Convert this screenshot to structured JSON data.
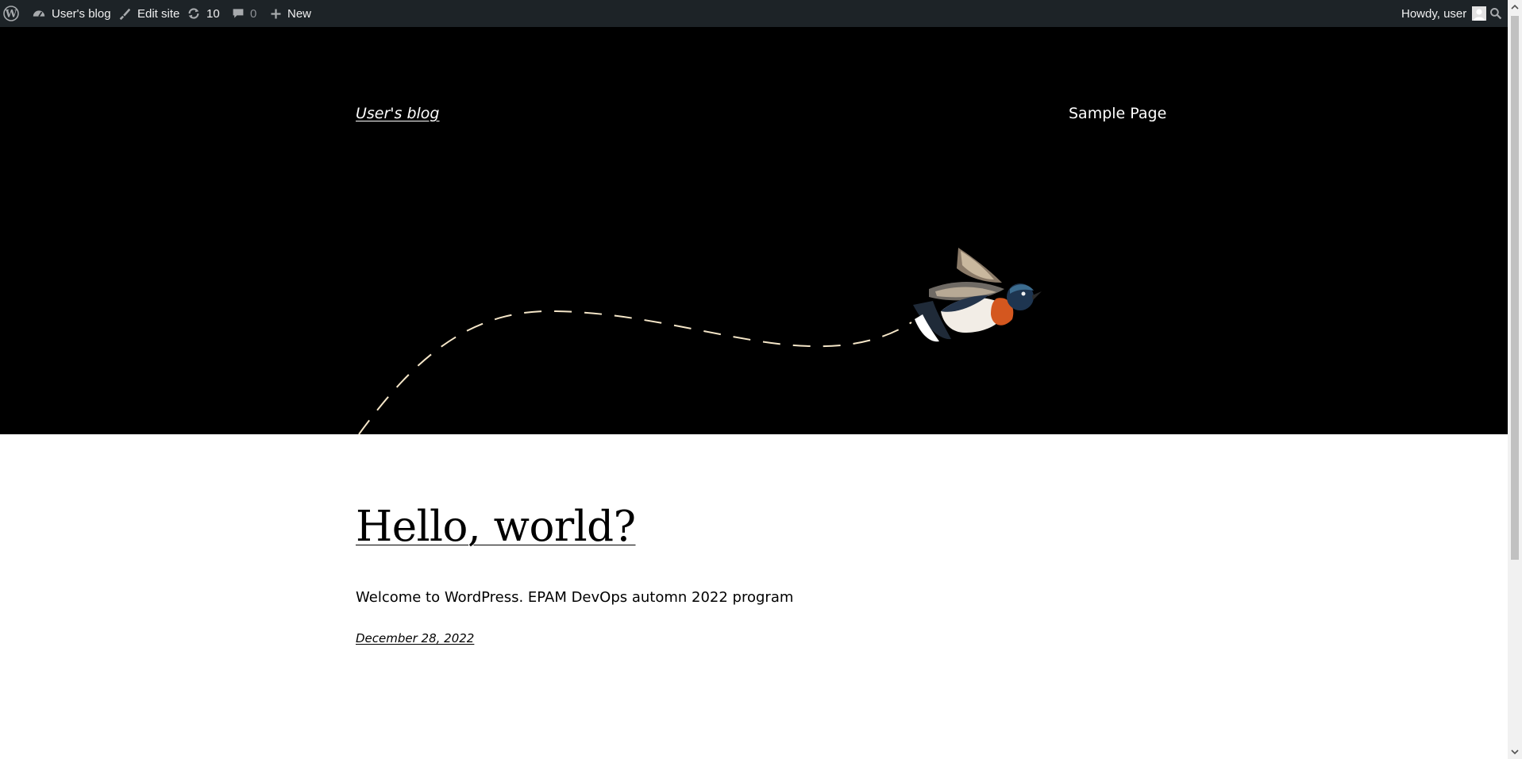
{
  "admin_bar": {
    "wp_logo_icon": "wordpress-logo-icon",
    "site_name": "User's blog",
    "edit_site": "Edit site",
    "updates_count": "10",
    "comments_count": "0",
    "new_label": "New",
    "howdy": "Howdy, user",
    "search_icon": "search-icon"
  },
  "header": {
    "site_title": "User's blog",
    "nav": [
      {
        "label": "Sample Page"
      }
    ]
  },
  "post": {
    "title": "Hello, world?",
    "excerpt": "Welcome to WordPress. EPAM DevOps automn 2022 program",
    "date": "December 28, 2022"
  },
  "colors": {
    "admin_bar_bg": "#1d2327",
    "header_bg": "#000000",
    "page_bg": "#ffffff",
    "text": "#000000",
    "flight_path": "#f5e6c8"
  }
}
